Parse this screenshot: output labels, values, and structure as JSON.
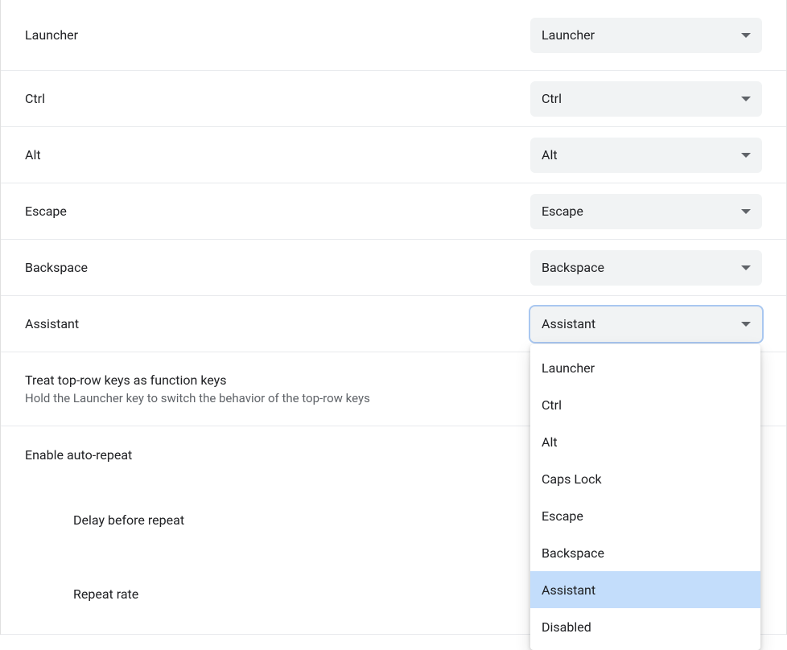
{
  "keys": [
    {
      "label": "Launcher",
      "value": "Launcher"
    },
    {
      "label": "Ctrl",
      "value": "Ctrl"
    },
    {
      "label": "Alt",
      "value": "Alt"
    },
    {
      "label": "Escape",
      "value": "Escape"
    },
    {
      "label": "Backspace",
      "value": "Backspace"
    },
    {
      "label": "Assistant",
      "value": "Assistant"
    }
  ],
  "topRow": {
    "label": "Treat top-row keys as function keys",
    "sublabel": "Hold the Launcher key to switch the behavior of the top-row keys"
  },
  "autoRepeat": {
    "label": "Enable auto-repeat",
    "delayLabel": "Delay before repeat",
    "rateLabel": "Repeat rate"
  },
  "dropdownOptions": [
    "Launcher",
    "Ctrl",
    "Alt",
    "Caps Lock",
    "Escape",
    "Backspace",
    "Assistant",
    "Disabled"
  ],
  "dropdownSelected": "Assistant"
}
